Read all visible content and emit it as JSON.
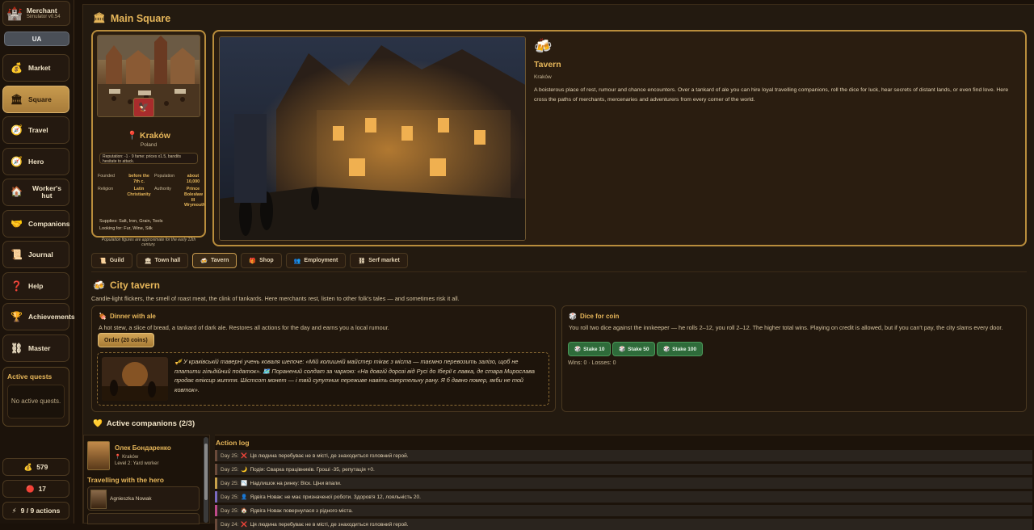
{
  "app": {
    "title": "Merchant",
    "version": "Simulator v0.54",
    "lang": "UA"
  },
  "nav": [
    {
      "label": "Market",
      "icon": "money-bag-icon"
    },
    {
      "label": "Square",
      "icon": "castle-icon"
    },
    {
      "label": "Travel",
      "icon": "compass-icon"
    },
    {
      "label": "Hero",
      "icon": "compass-icon"
    },
    {
      "label": "Worker's hut",
      "icon": "house-icon"
    },
    {
      "label": "Companions",
      "icon": "handshake-icon"
    },
    {
      "label": "Journal",
      "icon": "scroll-icon"
    },
    {
      "label": "Help",
      "icon": "question-icon"
    },
    {
      "label": "Achievements",
      "icon": "trophy-icon"
    },
    {
      "label": "Master",
      "icon": "chain-icon"
    }
  ],
  "active_quests": {
    "title": "Active quests",
    "empty": "No active quests."
  },
  "stats": {
    "gold": "579",
    "reputation": "17",
    "actions": "9 / 9 actions"
  },
  "page": {
    "title": "Main Square"
  },
  "city": {
    "name": "Kraków",
    "country": "Poland",
    "reputation": "Reputation: -1 · 9 fame: prices x1.5, bandits hesitate to attack.",
    "founded_label": "Founded",
    "founded": "before the 7th c.",
    "population_label": "Population",
    "population": "about 10,000",
    "religion_label": "Religion",
    "religion": "Latin Christianity",
    "authority_label": "Authority",
    "authority": "Prince Bolesław III Wrymouth",
    "supplies": "Supplies: Salt, Iron, Grain, Tools",
    "looking_for": "Looking for: Fur, Wine, Silk",
    "note": "Population figures are approximate for the early 12th century."
  },
  "location": {
    "title": "Tavern",
    "city": "Kraków",
    "description": "A boisterous place of rest, rumour and chance encounters. Over a tankard of ale you can hire loyal travelling companions, roll the dice for luck, hear secrets of distant lands, or even find love. Here cross the paths of merchants, mercenaries and adventurers from every corner of the world."
  },
  "tabs": [
    "Guild",
    "Town hall",
    "Tavern",
    "Shop",
    "Employment",
    "Serf market"
  ],
  "tavern": {
    "title": "City tavern",
    "description": "Candle-light flickers, the smell of roast meat, the clink of tankards. Here merchants rest, listen to other folk's tales — and sometimes risk it all.",
    "dinner": {
      "title": "Dinner with ale",
      "text": "A hot stew, a slice of bread, a tankard of dark ale. Restores all actions for the day and earns you a local rumour.",
      "button": "Order (20 coins)"
    },
    "rumour": "🎺 У краківській таверні учень коваля шепоче: «Мій колишній майстер тікає з міста — таємно перевозить залізо, щоб не платити гільдійний податок». 🗺️ Поранений солдат за чаркою: «На довгій дорозі від Русі до Іберії є лавка, де стара Мирослава продає еліксир життя. Шістсот монет — і твій супутник переживе навіть смертельну рану. Я б давно помер, якби не той ковток».",
    "dice": {
      "title": "Dice for coin",
      "text": "You roll two dice against the innkeeper — he rolls 2–12, you roll 2–12. The higher total wins. Playing on credit is allowed, but if you can't pay, the city slams every door.",
      "stakes": [
        "Stake 10",
        "Stake 50",
        "Stake 100"
      ],
      "record": "Wins: 0 · Losses: 0"
    }
  },
  "companions": {
    "title": "Active companions (2/3)",
    "leader": {
      "name": "Олек Бондаренко",
      "location": "Kraków",
      "level": "Level 2: Yard worker"
    },
    "travelling_title": "Travelling with the hero",
    "travelling": [
      "Agnieszka Nowak"
    ]
  },
  "log": {
    "title": "Action log",
    "entries": [
      {
        "day": "Day 25:",
        "icon": "❌",
        "text": "Ця людина перебуває не в місті, де знаходиться головний герой.",
        "color": "#6a4a3a"
      },
      {
        "day": "Day 25:",
        "icon": "🌙",
        "text": "Подія: Сварка працівників. Гроші -35, репутація +0.",
        "color": "#6a4a3a"
      },
      {
        "day": "Day 25:",
        "icon": "📉",
        "text": "Надлишок на ринку: Віск. Ціни впали.",
        "color": "#c9a24a"
      },
      {
        "day": "Day 25:",
        "icon": "👤",
        "text": "Ядвіга Новак: не має призначеної роботи. Здоров'я 12, лояльність 20.",
        "color": "#7a6ac0"
      },
      {
        "day": "Day 25:",
        "icon": "🏠",
        "text": "Ядвіга Новак повернулася з рідного міста.",
        "color": "#c04a8a"
      },
      {
        "day": "Day 24:",
        "icon": "❌",
        "text": "Ця людина перебуває не в місті, де знаходиться головний герой.",
        "color": "#6a4a3a"
      }
    ]
  }
}
